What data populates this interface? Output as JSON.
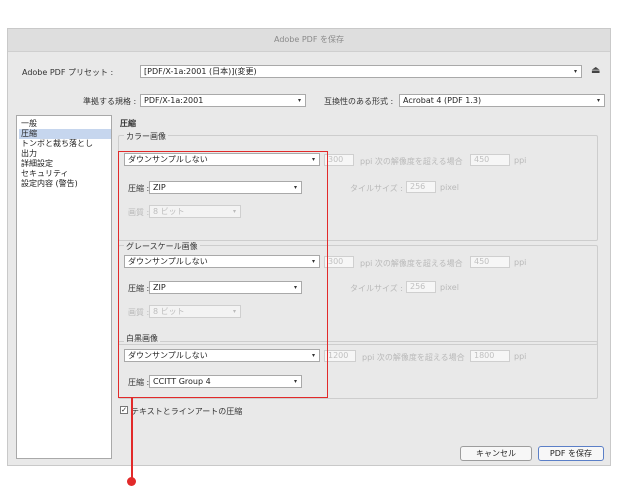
{
  "dialog": {
    "title": "Adobe PDF を保存",
    "preset_label": "Adobe PDF プリセット :",
    "preset_value": "[PDF/X-1a:2001 (日本)](変更)",
    "standard_label": "準拠する規格 :",
    "standard_value": "PDF/X-1a:2001",
    "compat_label": "互換性のある形式 :",
    "compat_value": "Acrobat 4 (PDF 1.3)"
  },
  "sidebar": {
    "items": [
      {
        "label": "一般"
      },
      {
        "label": "圧縮"
      },
      {
        "label": "トンボと裁ち落とし"
      },
      {
        "label": "出力"
      },
      {
        "label": "詳細設定"
      },
      {
        "label": "セキュリティ"
      },
      {
        "label": "設定内容 (警告)"
      }
    ]
  },
  "main": {
    "section_title": "圧縮",
    "color": {
      "title": "カラー画像",
      "downsample": "ダウンサンプルしない",
      "ppi_value": "300",
      "ppi_text": "ppi 次の解像度を超える場合",
      "ppi_value2": "450",
      "ppi_unit": "ppi",
      "compression_label": "圧縮 :",
      "compression_value": "ZIP",
      "tile_label": "タイルサイズ :",
      "tile_value": "256",
      "tile_unit": "pixel",
      "quality_label": "画質 :",
      "quality_value": "8 ビット"
    },
    "gray": {
      "title": "グレースケール画像",
      "downsample": "ダウンサンプルしない",
      "ppi_value": "300",
      "ppi_text": "ppi 次の解像度を超える場合",
      "ppi_value2": "450",
      "ppi_unit": "ppi",
      "compression_label": "圧縮 :",
      "compression_value": "ZIP",
      "tile_label": "タイルサイズ :",
      "tile_value": "256",
      "tile_unit": "pixel",
      "quality_label": "画質 :",
      "quality_value": "8 ビット"
    },
    "mono": {
      "title": "白黒画像",
      "downsample": "ダウンサンプルしない",
      "ppi_value": "1200",
      "ppi_text": "ppi 次の解像度を超える場合",
      "ppi_value2": "1800",
      "ppi_unit": "ppi",
      "compression_label": "圧縮 :",
      "compression_value": "CCITT Group 4"
    },
    "text_compress_label": "テキストとラインアートの圧縮",
    "text_compress_checked": "✓"
  },
  "buttons": {
    "cancel": "キャンセル",
    "save": "PDF を保存"
  },
  "icons": {
    "dropdown": "▾",
    "save_preset": "⏏"
  },
  "colors": {
    "highlight": "#e22a2a",
    "selection": "#c6d6ee"
  }
}
